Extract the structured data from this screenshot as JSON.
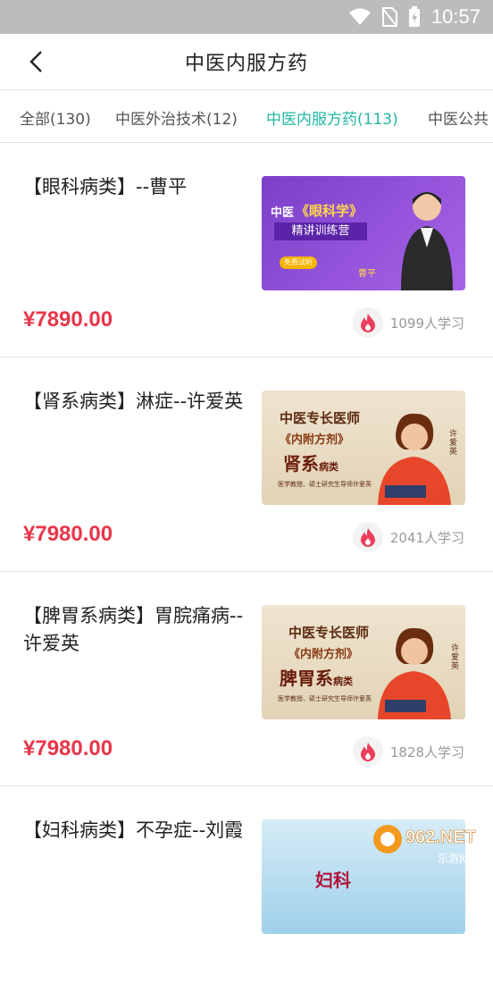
{
  "status": {
    "time": "10:57"
  },
  "nav": {
    "title": "中医内服方药"
  },
  "tabs": [
    {
      "label": "全部(130)"
    },
    {
      "label": "中医外治技术(12)"
    },
    {
      "label": "中医内服方药(113)"
    },
    {
      "label": "中医公共"
    }
  ],
  "courses": [
    {
      "title": "【眼科病类】--曹平",
      "price": "¥7890.00",
      "learners": "1099人学习",
      "thumb": {
        "tag": "中医",
        "headline": "《眼科学》",
        "sub": "精讲训练营",
        "name": "曹平",
        "btn": "免费试听"
      }
    },
    {
      "title": "【肾系病类】淋症--许爱英",
      "price": "¥7980.00",
      "learners": "2041人学习",
      "thumb": {
        "top": "中医专长医师",
        "book": "《内附方剂》",
        "cat": "肾系",
        "catsub": "病类",
        "name": "许爱英",
        "desc": "医学教授、硕士研究生导师许爱英"
      }
    },
    {
      "title": "【脾胃系病类】胃脘痛病--许爱英",
      "price": "¥7980.00",
      "learners": "1828人学习",
      "thumb": {
        "top": "中医专长医师",
        "book": "《内附方剂》",
        "cat": "脾胃系",
        "catsub": "病类",
        "name": "许爱英",
        "desc": "医学教授、硕士研究生导师许爱英"
      }
    },
    {
      "title": "【妇科病类】不孕症--刘霞",
      "thumb": {
        "cat": "妇科"
      }
    }
  ],
  "watermark": {
    "brand": "962.NET",
    "sub": "乐游网"
  },
  "colors": {
    "accent": "#20b7a0",
    "price": "#e8364a"
  }
}
